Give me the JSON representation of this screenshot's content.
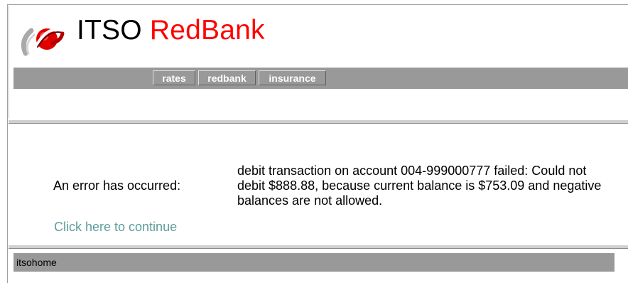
{
  "header": {
    "brand_prefix": "ITSO",
    "brand_name": "RedBank",
    "logo_icon": "itso-redbank-logo-icon"
  },
  "nav": {
    "items": [
      {
        "label": "rates"
      },
      {
        "label": "redbank"
      },
      {
        "label": "insurance"
      }
    ]
  },
  "main": {
    "error_label": "An error has occurred:",
    "error_message": "debit transaction on account 004-999000777 failed: Could not debit $888.88, because current balance is $753.09 and negative balances are not allowed.",
    "continue_link": "Click here to continue"
  },
  "footer": {
    "link": "itsohome"
  },
  "colors": {
    "brand_red": "#ff0000",
    "bar_gray": "#999999",
    "link_teal": "#5f9c9c"
  }
}
